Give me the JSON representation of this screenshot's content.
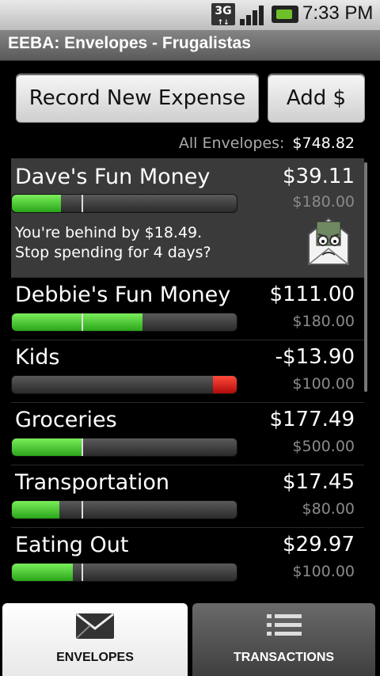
{
  "status": {
    "network": "3G",
    "time": "7:33 PM"
  },
  "app": {
    "title": "EEBA: Envelopes - Frugalistas"
  },
  "actions": {
    "record_label": "Record New Expense",
    "add_label": "Add $"
  },
  "summary": {
    "label": "All Envelopes:",
    "total": "$748.82"
  },
  "envelopes": [
    {
      "name": "Dave's Fun Money",
      "amount": "$39.11",
      "budget": "$180.00",
      "progress": 0.22,
      "warning_line1": "You're behind by $18.49.",
      "warning_line2": "Stop spending for 4 days?"
    },
    {
      "name": "Debbie's Fun Money",
      "amount": "$111.00",
      "budget": "$180.00",
      "progress": 0.58
    },
    {
      "name": "Kids",
      "amount": "-$13.90",
      "budget": "$100.00",
      "progress": -0.1
    },
    {
      "name": "Groceries",
      "amount": "$177.49",
      "budget": "$500.00",
      "progress": 0.31
    },
    {
      "name": "Transportation",
      "amount": "$17.45",
      "budget": "$80.00",
      "progress": 0.21
    },
    {
      "name": "Eating Out",
      "amount": "$29.97",
      "budget": "$100.00",
      "progress": 0.27
    }
  ],
  "tabs": [
    {
      "label": "ENVELOPES",
      "icon": "envelope-icon",
      "selected": true
    },
    {
      "label": "TRANSACTIONS",
      "icon": "list-icon",
      "selected": false
    }
  ],
  "colors": {
    "progress_green": "#2aa51a",
    "overdraft_red": "#c0160f",
    "title_bar": "#6e6e6e"
  }
}
